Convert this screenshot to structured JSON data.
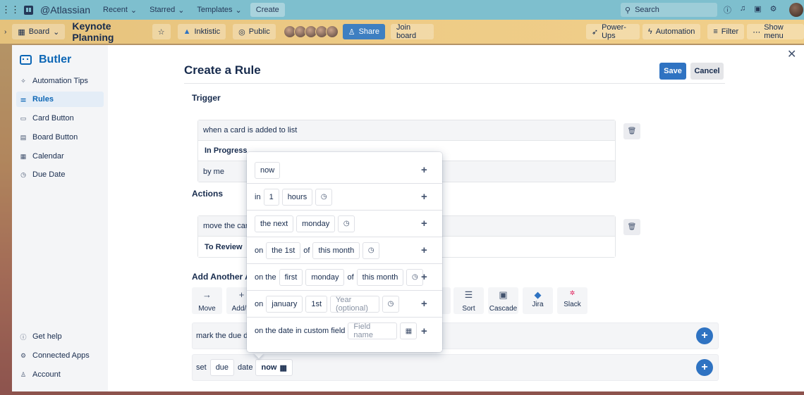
{
  "topnav": {
    "brand": "@Atlassian",
    "recent": "Recent",
    "starred": "Starred",
    "templates": "Templates",
    "create": "Create",
    "search_placeholder": "Search"
  },
  "board": {
    "view": "Board",
    "title": "Keynote Planning",
    "workspace": "Inktistic",
    "visibility": "Public",
    "share": "Share",
    "join": "Join board",
    "powerups": "Power-Ups",
    "automation": "Automation",
    "filter": "Filter",
    "show_menu": "Show menu"
  },
  "sidebar": {
    "title": "Butler",
    "items": [
      {
        "label": "Automation Tips",
        "icon": "sparkle-icon"
      },
      {
        "label": "Rules",
        "icon": "sliders-icon",
        "active": true
      },
      {
        "label": "Card Button",
        "icon": "card-icon"
      },
      {
        "label": "Board Button",
        "icon": "board-icon"
      },
      {
        "label": "Calendar",
        "icon": "calendar-icon"
      },
      {
        "label": "Due Date",
        "icon": "clock-icon"
      }
    ],
    "bottom": [
      {
        "label": "Get help",
        "icon": "info-icon"
      },
      {
        "label": "Connected Apps",
        "icon": "gear-icon"
      },
      {
        "label": "Account",
        "icon": "person-icon"
      }
    ]
  },
  "rule": {
    "title": "Create a Rule",
    "save": "Save",
    "cancel": "Cancel",
    "trigger_heading": "Trigger",
    "trigger_lines": [
      "when a card is added to list",
      "In Progress",
      "by me"
    ],
    "actions_heading": "Actions",
    "action_lines": [
      "move the card",
      "To Review"
    ],
    "add_another_heading": "Add Another Ac",
    "action_tiles": [
      {
        "label": "Move",
        "icon": "arrow-right-icon"
      },
      {
        "label": "Add/R",
        "icon": "plus-icon"
      },
      {
        "label": "s",
        "icon": "list-icon"
      },
      {
        "label": "Sort",
        "icon": "sort-icon"
      },
      {
        "label": "Cascade",
        "icon": "cascade-icon"
      },
      {
        "label": "Jira",
        "icon": "jira-icon"
      },
      {
        "label": "Slack",
        "icon": "slack-icon"
      }
    ],
    "due_line_text": "mark the due dat",
    "set_line": {
      "set": "set",
      "field": "due",
      "date": "date",
      "value": "now"
    }
  },
  "popover": {
    "rows": [
      {
        "parts": [
          {
            "type": "chip",
            "text": "now"
          }
        ]
      },
      {
        "parts": [
          {
            "type": "text",
            "text": "in"
          },
          {
            "type": "chip",
            "text": "1"
          },
          {
            "type": "chip",
            "text": "hours"
          },
          {
            "type": "clock"
          }
        ]
      },
      {
        "parts": [
          {
            "type": "chip",
            "text": "the next"
          },
          {
            "type": "chip",
            "text": "monday"
          },
          {
            "type": "clock"
          }
        ]
      },
      {
        "parts": [
          {
            "type": "text",
            "text": "on"
          },
          {
            "type": "chip",
            "text": "the 1st"
          },
          {
            "type": "text",
            "text": "of"
          },
          {
            "type": "chip",
            "text": "this month"
          },
          {
            "type": "clock"
          }
        ]
      },
      {
        "parts": [
          {
            "type": "text",
            "text": "on the"
          },
          {
            "type": "chip",
            "text": "first"
          },
          {
            "type": "chip",
            "text": "monday"
          },
          {
            "type": "text",
            "text": "of"
          },
          {
            "type": "chip",
            "text": "this month"
          },
          {
            "type": "clock"
          }
        ]
      },
      {
        "parts": [
          {
            "type": "text",
            "text": "on"
          },
          {
            "type": "chip",
            "text": "january"
          },
          {
            "type": "chip",
            "text": "1st"
          },
          {
            "type": "input",
            "text": "Year (optional)"
          },
          {
            "type": "clock"
          }
        ]
      },
      {
        "parts": [
          {
            "type": "text",
            "text": "on the date in custom field"
          },
          {
            "type": "input",
            "text": "Field name"
          },
          {
            "type": "calendar"
          }
        ]
      }
    ],
    "plus": "+"
  },
  "colors": {
    "primary": "#2f73c2",
    "topnav": "#7ebfce",
    "sidebar_active": "#e4edf7"
  }
}
